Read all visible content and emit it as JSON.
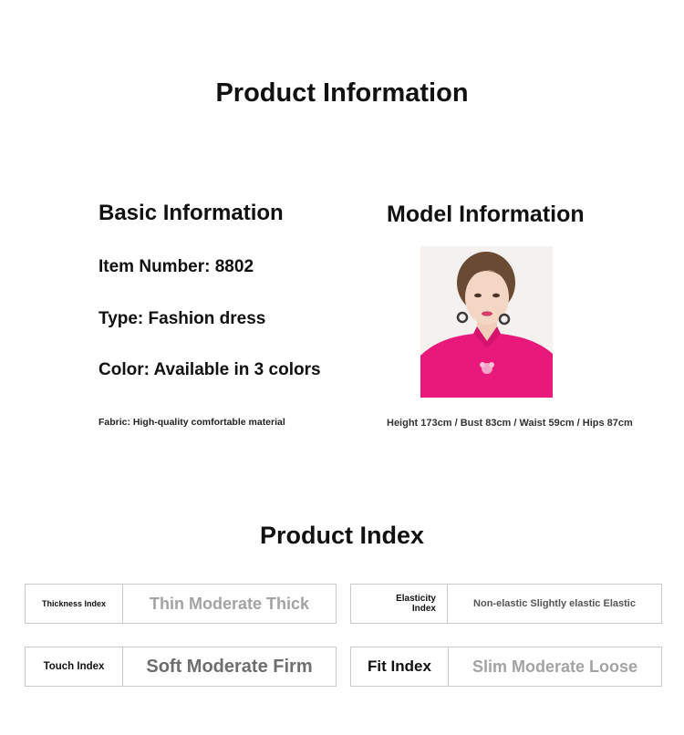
{
  "header": {
    "title": "Product Information"
  },
  "basic": {
    "heading": "Basic Information",
    "item_number": "Item Number: 8802",
    "type": "Type: Fashion dress",
    "color": "Color: Available in 3 colors",
    "fabric": "Fabric: High-quality comfortable material"
  },
  "model": {
    "heading": "Model Information",
    "measurements": "Height 173cm / Bust 83cm / Waist 59cm / Hips 87cm"
  },
  "index": {
    "title": "Product Index",
    "thickness": {
      "label": "Thickness Index",
      "values": "Thin Moderate Thick"
    },
    "elasticity": {
      "label_line1": "Elasticity",
      "label_line2": "Index",
      "values": "Non-elastic Slightly elastic Elastic"
    },
    "touch": {
      "label": "Touch Index",
      "values": "Soft Moderate Firm"
    },
    "fit": {
      "label": "Fit Index",
      "values": "Slim Moderate Loose"
    }
  },
  "colors": {
    "dress": "#e8197a",
    "text": "#111111",
    "muted": "#9a9a9a",
    "border": "#c9c9c9"
  }
}
